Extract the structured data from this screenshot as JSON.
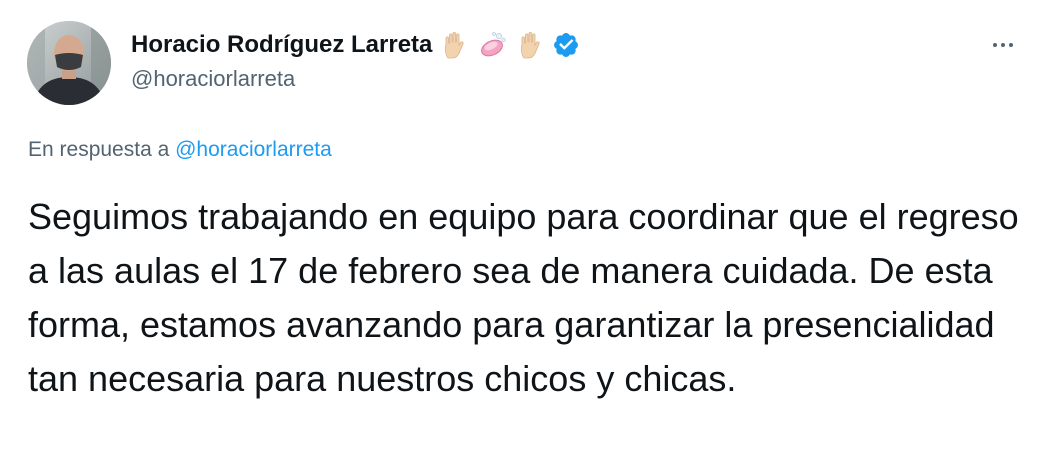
{
  "tweet": {
    "author": {
      "display_name": "Horacio Rodríguez Larreta",
      "handle": "@horaciorlarreta",
      "name_emojis": [
        "raised-hand-emoji",
        "soap-emoji",
        "raised-hand-emoji"
      ],
      "verified": true
    },
    "reply": {
      "prefix": "En respuesta a",
      "mention": "@horaciorlarreta"
    },
    "text": "Seguimos trabajando en equipo para coordinar que el regreso a las aulas el 17 de febrero sea de manera cuidada. De esta forma, estamos avanzando para garantizar la presencialidad tan necesaria para nuestros chicos y chicas.",
    "more_menu_icon": "more-horizontal-icon"
  },
  "colors": {
    "text_primary": "#0f1419",
    "text_secondary": "#536471",
    "accent": "#1d9bf0"
  }
}
